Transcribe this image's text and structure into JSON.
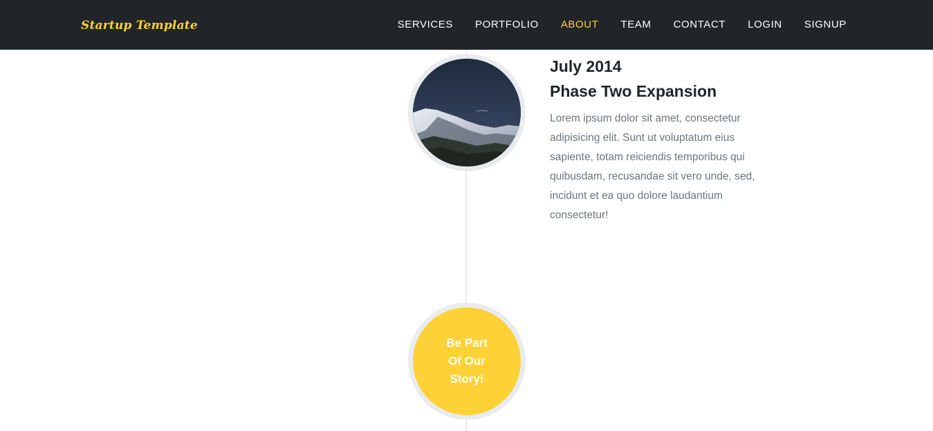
{
  "navbar": {
    "brand": "Startup Template",
    "links": [
      {
        "label": "SERVICES"
      },
      {
        "label": "PORTFOLIO"
      },
      {
        "label": "ABOUT"
      },
      {
        "label": "TEAM"
      },
      {
        "label": "CONTACT"
      },
      {
        "label": "LOGIN"
      },
      {
        "label": "SIGNUP"
      }
    ],
    "active_link": "ABOUT"
  },
  "timeline": {
    "item": {
      "date": "July 2014",
      "title": "Phase Two Expansion",
      "body": "Lorem ipsum dolor sit amet, consectetur adipisicing elit. Sunt ut voluptatum eius sapiente, totam reiciendis temporibus qui quibusdam, recusandae sit vero unde, sed, incidunt et ea quo dolore laudantium consectetur!"
    },
    "cta": {
      "text": "Be Part\nOf Our\nStory!"
    }
  },
  "colors": {
    "navbar_bg": "#212529",
    "accent": "#fed136",
    "timeline_border": "#e9ecef",
    "body_text": "#6c757d",
    "heading_text": "#212529"
  },
  "icons": {
    "timeline_photo": "snowy-mountain-night-photo"
  }
}
